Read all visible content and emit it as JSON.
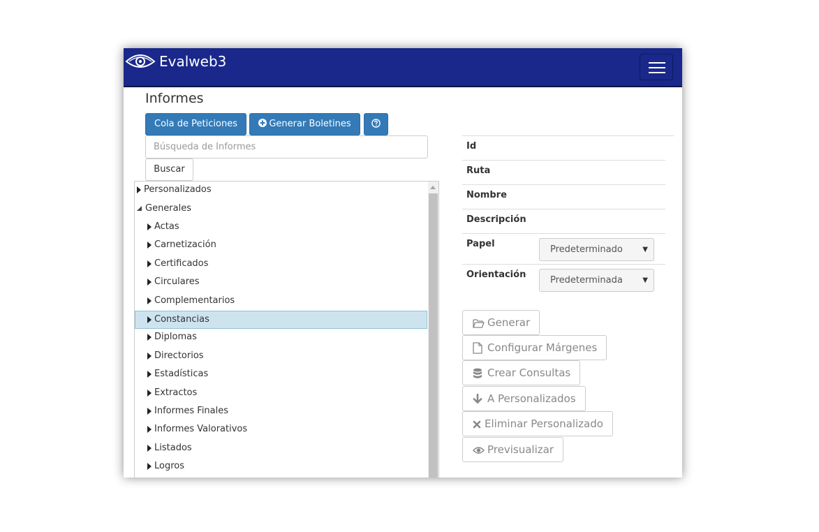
{
  "app": {
    "brand": "Evalweb3"
  },
  "page": {
    "title": "Informes"
  },
  "toolbar": {
    "queue_label": "Cola de Peticiones",
    "generate_bulletins_label": "Generar Boletines",
    "help_icon": "question-circle-icon"
  },
  "search": {
    "placeholder": "Búsqueda de Informes",
    "value": "",
    "button_label": "Buscar"
  },
  "tree": {
    "root_personalizados": "Personalizados",
    "root_generales": "Generales",
    "children": [
      "Actas",
      "Carnetización",
      "Certificados",
      "Circulares",
      "Complementarios",
      "Constancias",
      "Diplomas",
      "Directorios",
      "Estadísticas",
      "Extractos",
      "Informes Finales",
      "Informes Valorativos",
      "Listados",
      "Logros"
    ],
    "selected": "Constancias"
  },
  "details": {
    "id_label": "Id",
    "ruta_label": "Ruta",
    "nombre_label": "Nombre",
    "descripcion_label": "Descripción",
    "papel_label": "Papel",
    "papel_value": "Predeterminado",
    "orientacion_label": "Orientación",
    "orientacion_value": "Predeterminada"
  },
  "actions": {
    "generar": "Generar",
    "configurar_margenes": "Configurar Márgenes",
    "crear_consultas": "Crear Consultas",
    "a_personalizados": "A Personalizados",
    "eliminar_personalizado": "Eliminar Personalizado",
    "previsualizar": "Previsualizar"
  },
  "colors": {
    "navbar": "#19288a",
    "primary": "#337ab7",
    "selected_row": "#cde4ef"
  }
}
